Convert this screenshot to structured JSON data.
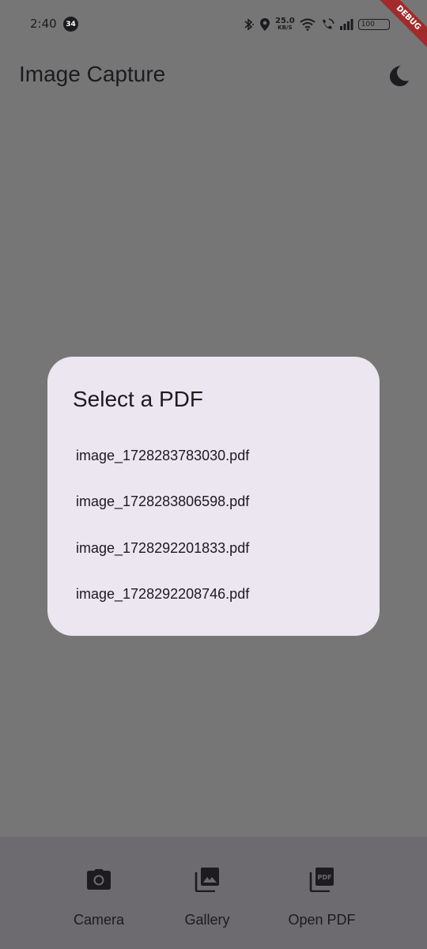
{
  "status_bar": {
    "time": "2:40",
    "notification_count": "34",
    "net_speed_value": "25.0",
    "net_speed_unit": "KB/S",
    "battery": "100"
  },
  "debug_banner": "DEBUG",
  "app_bar": {
    "title": "Image Capture",
    "theme_icon": "moon-icon"
  },
  "dialog": {
    "title": "Select a PDF",
    "files": [
      "image_1728283783030.pdf",
      "image_1728283806598.pdf",
      "image_1728292201833.pdf",
      "image_1728292208746.pdf"
    ]
  },
  "bottom_nav": {
    "items": [
      {
        "label": "Camera",
        "icon": "camera-icon"
      },
      {
        "label": "Gallery",
        "icon": "gallery-icon"
      },
      {
        "label": "Open PDF",
        "icon": "pdf-icon"
      }
    ]
  },
  "colors": {
    "scrim_background": "#767676",
    "dialog_surface": "#ece6f0",
    "bottom_nav": "#6e6b70",
    "text": "#1c1b1f",
    "debug_banner": "#a32a2a"
  }
}
